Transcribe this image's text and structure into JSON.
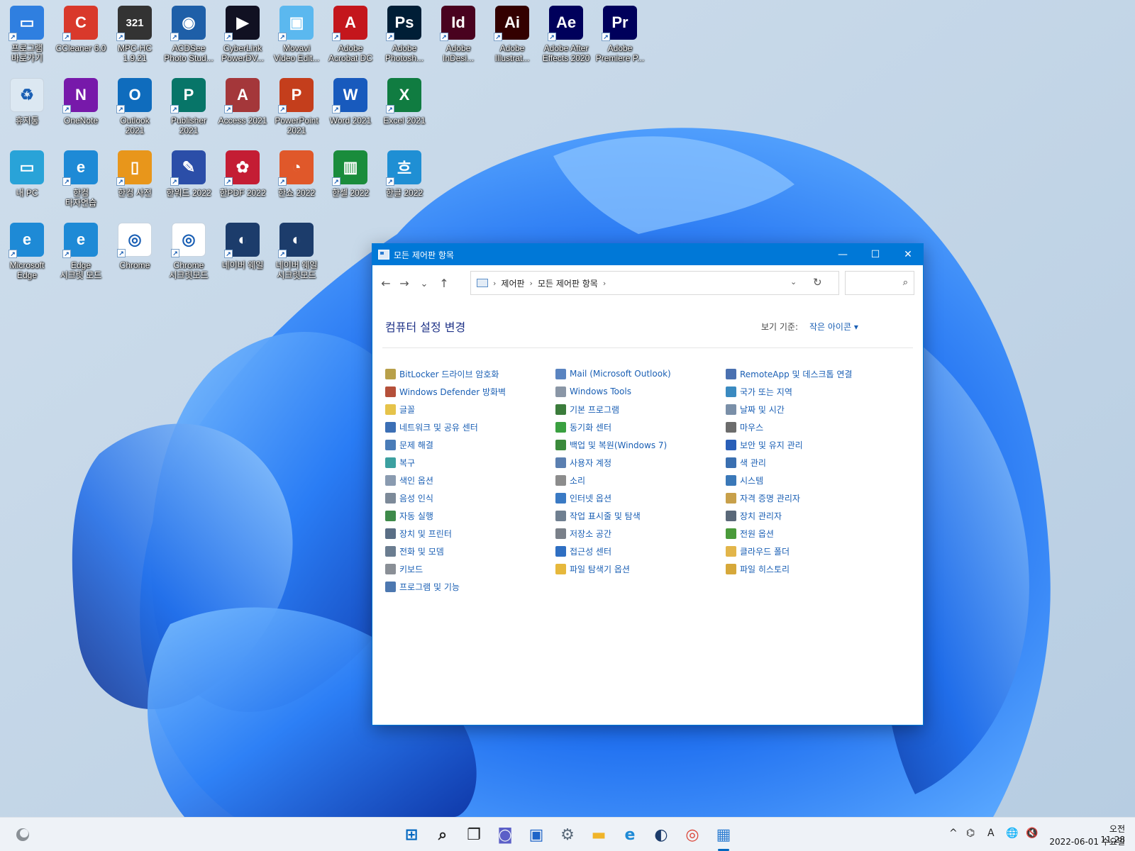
{
  "desktop_icons": [
    {
      "label": "프로그램\n바로가기",
      "icon": "tv-icon",
      "color": "#2f7fe0",
      "glyph": "▭"
    },
    {
      "label": "CCleaner 6.0",
      "icon": "ccleaner-icon",
      "color": "#d9392b",
      "glyph": "C"
    },
    {
      "label": "MPC-HC\n1.9.21",
      "icon": "mpc-hc-icon",
      "color": "#333333",
      "glyph": "321"
    },
    {
      "label": "ACDSee\nPhoto Stud...",
      "icon": "acdsee-icon",
      "color": "#1e5fa8",
      "glyph": "◉"
    },
    {
      "label": "CyberLink\nPowerDV...",
      "icon": "powerdvd-icon",
      "color": "#111122",
      "glyph": "▶"
    },
    {
      "label": "Movavi\nVideo Edit...",
      "icon": "movavi-icon",
      "color": "#5bb8ef",
      "glyph": "▣"
    },
    {
      "label": "Adobe\nAcrobat DC",
      "icon": "acrobat-icon",
      "color": "#c4161c",
      "glyph": "A"
    },
    {
      "label": "Adobe\nPhotosh...",
      "icon": "photoshop-icon",
      "color": "#001e36",
      "glyph": "Ps"
    },
    {
      "label": "Adobe\nInDesi...",
      "icon": "indesign-icon",
      "color": "#49021f",
      "glyph": "Id"
    },
    {
      "label": "Adobe\nIllustrat...",
      "icon": "illustrator-icon",
      "color": "#330000",
      "glyph": "Ai"
    },
    {
      "label": "Adobe After\nEffects 2020",
      "icon": "after-effects-icon",
      "color": "#00005b",
      "glyph": "Ae"
    },
    {
      "label": "Adobe\nPremiere P...",
      "icon": "premiere-icon",
      "color": "#00005b",
      "glyph": "Pr"
    },
    {
      "label": "휴지통",
      "icon": "recycle-bin-icon",
      "color": "#dce8f2",
      "glyph": "♻"
    },
    {
      "label": "OneNote",
      "icon": "onenote-icon",
      "color": "#7719aa",
      "glyph": "N"
    },
    {
      "label": "Outlook\n2021",
      "icon": "outlook-icon",
      "color": "#0f6cbd",
      "glyph": "O"
    },
    {
      "label": "Publisher\n2021",
      "icon": "publisher-icon",
      "color": "#077568",
      "glyph": "P"
    },
    {
      "label": "Access 2021",
      "icon": "access-icon",
      "color": "#a4373a",
      "glyph": "A"
    },
    {
      "label": "PowerPoint\n2021",
      "icon": "powerpoint-icon",
      "color": "#c43e1c",
      "glyph": "P"
    },
    {
      "label": "Word 2021",
      "icon": "word-icon",
      "color": "#185abd",
      "glyph": "W"
    },
    {
      "label": "Excel 2021",
      "icon": "excel-icon",
      "color": "#107c41",
      "glyph": "X"
    },
    {
      "label": "내 PC",
      "icon": "this-pc-icon",
      "color": "#29a3d8",
      "glyph": "▭"
    },
    {
      "label": "한컴\n타자연습",
      "icon": "edge-typing-icon",
      "color": "#1e8ad6",
      "glyph": "e"
    },
    {
      "label": "한컴 사전",
      "icon": "hancom-dictionary-icon",
      "color": "#e8961b",
      "glyph": "▯"
    },
    {
      "label": "한워드 2022",
      "icon": "hanword-icon",
      "color": "#2b4ea8",
      "glyph": "✎"
    },
    {
      "label": "한PDF 2022",
      "icon": "hanpdf-icon",
      "color": "#c41d34",
      "glyph": "✿"
    },
    {
      "label": "한쇼 2022",
      "icon": "hanshow-icon",
      "color": "#e0582a",
      "glyph": "◔"
    },
    {
      "label": "한셀 2022",
      "icon": "hancell-icon",
      "color": "#1a8c3c",
      "glyph": "▥"
    },
    {
      "label": "한글 2022",
      "icon": "hangul-icon",
      "color": "#1f8fd4",
      "glyph": "흐"
    },
    {
      "label": "Microsoft\nEdge",
      "icon": "edge-icon",
      "color": "#1e8ad6",
      "glyph": "e"
    },
    {
      "label": "Edge\n시크릿 모드",
      "icon": "edge-inprivate-icon",
      "color": "#1e8ad6",
      "glyph": "e"
    },
    {
      "label": "Chrome",
      "icon": "chrome-icon",
      "color": "#ffffff",
      "glyph": "◎"
    },
    {
      "label": "Chrome\n시크릿모드",
      "icon": "chrome-incognito-icon",
      "color": "#ffffff",
      "glyph": "◎"
    },
    {
      "label": "네이버 웨일",
      "icon": "whale-icon",
      "color": "#1c3c6b",
      "glyph": "◐"
    },
    {
      "label": "네이버 웨일\n시크릿모드",
      "icon": "whale-private-icon",
      "color": "#1c3c6b",
      "glyph": "◐"
    }
  ],
  "window": {
    "title": "모든 제어판 항목",
    "controls": {
      "minimize": "—",
      "maximize": "☐",
      "close": "✕"
    },
    "nav": {
      "back": "←",
      "forward": "→",
      "recent": "⌄",
      "up": "↑"
    },
    "breadcrumb": [
      "제어판",
      "모든 제어판 항목"
    ],
    "address_dropdown": "⌄",
    "refresh": "↻",
    "search_placeholder": "",
    "heading": "컴퓨터 설정 변경",
    "view_by_label": "보기 기준:",
    "view_by_value": "작은 아이콘 ▾",
    "columns": [
      [
        {
          "label": "BitLocker 드라이브 암호화",
          "icon": "bitlocker-icon",
          "color": "#b8a04a"
        },
        {
          "label": "Windows Defender 방화벽",
          "icon": "firewall-icon",
          "color": "#b5503a"
        },
        {
          "label": "글꼴",
          "icon": "fonts-icon",
          "color": "#e6c34a"
        },
        {
          "label": "네트워크 및 공유 센터",
          "icon": "network-icon",
          "color": "#3c6fb5"
        },
        {
          "label": "문제 해결",
          "icon": "troubleshoot-icon",
          "color": "#4a7cb8"
        },
        {
          "label": "복구",
          "icon": "recovery-icon",
          "color": "#3ca0a0"
        },
        {
          "label": "색인 옵션",
          "icon": "indexing-icon",
          "color": "#8a9bb0"
        },
        {
          "label": "음성 인식",
          "icon": "speech-icon",
          "color": "#7d8a99"
        },
        {
          "label": "자동 실행",
          "icon": "autoplay-icon",
          "color": "#3e8a4a"
        },
        {
          "label": "장치 및 프린터",
          "icon": "printer-icon",
          "color": "#5a6e85"
        },
        {
          "label": "전화 및 모뎀",
          "icon": "phone-modem-icon",
          "color": "#6b7d90"
        },
        {
          "label": "키보드",
          "icon": "keyboard-icon",
          "color": "#8a8f96"
        },
        {
          "label": "프로그램 및 기능",
          "icon": "programs-icon",
          "color": "#4d78b0"
        }
      ],
      [
        {
          "label": "Mail (Microsoft Outlook)",
          "icon": "mail-icon",
          "color": "#5a84c0"
        },
        {
          "label": "Windows Tools",
          "icon": "windows-tools-icon",
          "color": "#8a96a6"
        },
        {
          "label": "기본 프로그램",
          "icon": "default-programs-icon",
          "color": "#3b7c3b"
        },
        {
          "label": "동기화 센터",
          "icon": "sync-center-icon",
          "color": "#3aa040"
        },
        {
          "label": "백업 및 복원(Windows 7)",
          "icon": "backup-icon",
          "color": "#3b8a3b"
        },
        {
          "label": "사용자 계정",
          "icon": "user-accounts-icon",
          "color": "#5b7fb0"
        },
        {
          "label": "소리",
          "icon": "sound-icon",
          "color": "#8c8c8c"
        },
        {
          "label": "인터넷 옵션",
          "icon": "internet-options-icon",
          "color": "#3a7ac4"
        },
        {
          "label": "작업 표시줄 및 탐색",
          "icon": "taskbar-nav-icon",
          "color": "#6f7f90"
        },
        {
          "label": "저장소 공간",
          "icon": "storage-spaces-icon",
          "color": "#7a8089"
        },
        {
          "label": "접근성 센터",
          "icon": "ease-of-access-icon",
          "color": "#2f6fc2"
        },
        {
          "label": "파일 탐색기 옵션",
          "icon": "folder-options-icon",
          "color": "#e6b83c"
        }
      ],
      [
        {
          "label": "RemoteApp 및 데스크톱 연결",
          "icon": "remoteapp-icon",
          "color": "#4a70b0"
        },
        {
          "label": "국가 또는 지역",
          "icon": "region-icon",
          "color": "#3a8ac0"
        },
        {
          "label": "날짜 및 시간",
          "icon": "date-time-icon",
          "color": "#7a8fa8"
        },
        {
          "label": "마우스",
          "icon": "mouse-icon",
          "color": "#6c6c6c"
        },
        {
          "label": "보안 및 유지 관리",
          "icon": "security-flag-icon",
          "color": "#2a5fb8"
        },
        {
          "label": "색 관리",
          "icon": "color-management-icon",
          "color": "#3a6fb0"
        },
        {
          "label": "시스템",
          "icon": "system-icon",
          "color": "#3a78b8"
        },
        {
          "label": "자격 증명 관리자",
          "icon": "credential-icon",
          "color": "#c8a04a"
        },
        {
          "label": "장치 관리자",
          "icon": "device-manager-icon",
          "color": "#5a6878"
        },
        {
          "label": "전원 옵션",
          "icon": "power-options-icon",
          "color": "#4a9a3a"
        },
        {
          "label": "클라우드 폴더",
          "icon": "work-folders-icon",
          "color": "#e2b54a"
        },
        {
          "label": "파일 히스토리",
          "icon": "file-history-icon",
          "color": "#d6a83a"
        }
      ]
    ]
  },
  "taskbar": {
    "widgets_icon": "weather-icon",
    "apps": [
      {
        "name": "start-button",
        "glyph": "⊞",
        "color": "#0067c0"
      },
      {
        "name": "search-button",
        "glyph": "⌕",
        "color": "#222222"
      },
      {
        "name": "task-view-button",
        "glyph": "❐",
        "color": "#222222"
      },
      {
        "name": "chat-button",
        "glyph": "◙",
        "color": "#5b5fc7"
      },
      {
        "name": "store-button",
        "glyph": "▣",
        "color": "#1e64c8"
      },
      {
        "name": "settings-button",
        "glyph": "⚙",
        "color": "#5a6a7a"
      },
      {
        "name": "file-explorer-button",
        "glyph": "▬",
        "color": "#f0b429"
      },
      {
        "name": "edge-button",
        "glyph": "e",
        "color": "#1e8ad6"
      },
      {
        "name": "whale-button",
        "glyph": "◐",
        "color": "#1c3c6b"
      },
      {
        "name": "chrome-button",
        "glyph": "◎",
        "color": "#db4437"
      },
      {
        "name": "control-panel-button",
        "glyph": "▦",
        "color": "#2d7dd2"
      }
    ],
    "tray": {
      "chevron": "^",
      "usb": "⌬",
      "ime": "A",
      "network": "🌐",
      "volume": "🔇"
    },
    "clock": {
      "time": "오전 11:28",
      "date": "2022-06-01 수요일"
    }
  }
}
